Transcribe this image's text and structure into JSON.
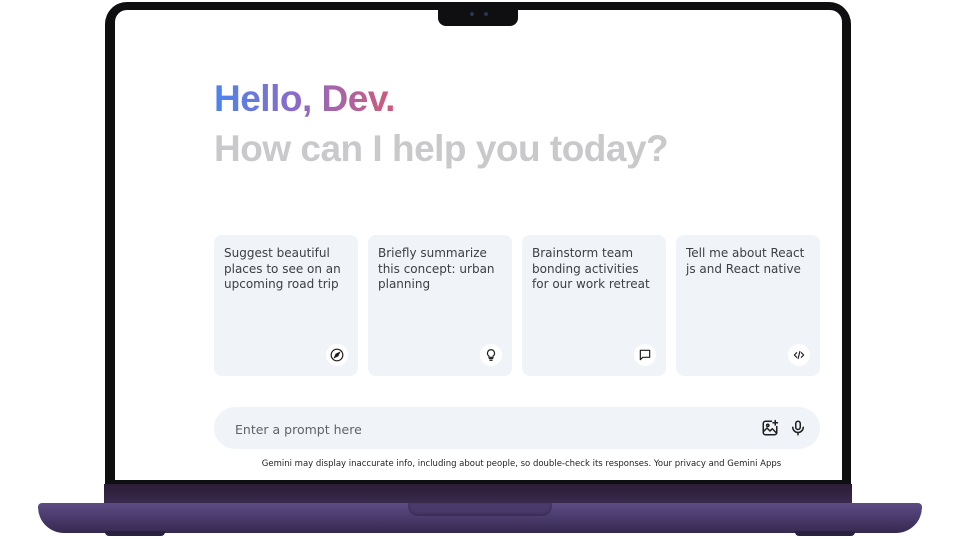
{
  "greeting": {
    "hello": "Hello, Dev.",
    "subtitle": "How can I help you today?"
  },
  "cards": [
    {
      "text": "Suggest beautiful places to see on an upcoming road trip",
      "icon": "compass-icon"
    },
    {
      "text": "Briefly summarize this concept: urban planning",
      "icon": "lightbulb-icon"
    },
    {
      "text": "Brainstorm team bonding activities for our work retreat",
      "icon": "chat-bubble-icon"
    },
    {
      "text": "Tell me about React js and React native",
      "icon": "code-icon"
    }
  ],
  "prompt": {
    "placeholder": "Enter a prompt here",
    "image_button_icon": "add-image-icon",
    "mic_button_icon": "microphone-icon"
  },
  "disclaimer": "Gemini may display inaccurate info, including about people, so double-check its responses. Your privacy and Gemini Apps",
  "colors": {
    "gradient_start": "#4c84ee",
    "gradient_end": "#cf5b78",
    "subtitle": "#c9c9cc",
    "card_bg": "#f0f3f8",
    "laptop_body": "#4b3c6e"
  }
}
